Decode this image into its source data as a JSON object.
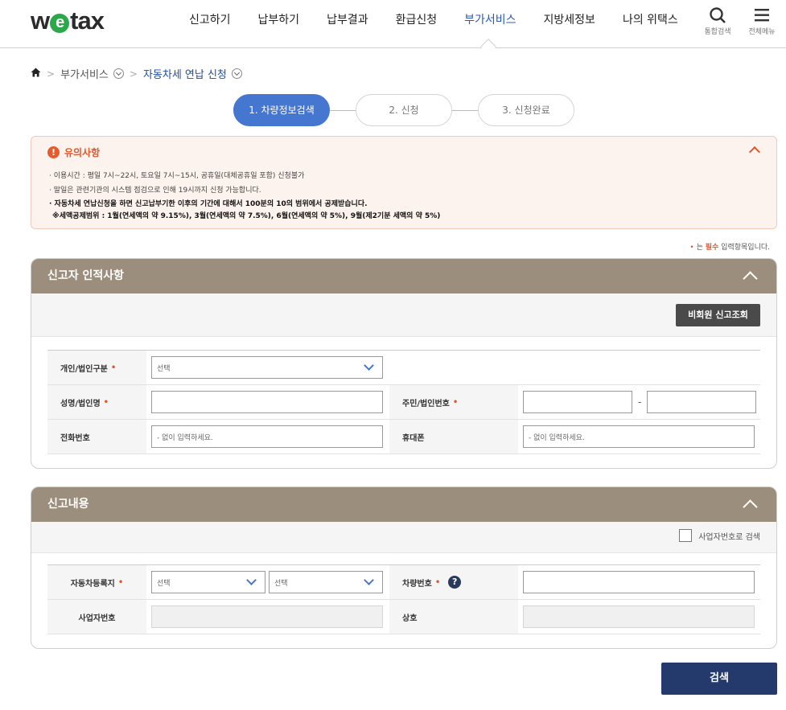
{
  "header": {
    "logo_pre": "w",
    "logo_e": "e",
    "logo_post": "tax",
    "menu": [
      "신고하기",
      "납부하기",
      "납부결과",
      "환급신청",
      "부가서비스",
      "지방세정보",
      "나의 위택스"
    ],
    "active_menu": "부가서비스",
    "search_label": "통합검색",
    "all_menu_label": "전체메뉴"
  },
  "breadcrumb": {
    "parent": "부가서비스",
    "current": "자동차세 연납 신청"
  },
  "steps": [
    "1. 차량정보검색",
    "2. 신청",
    "3. 신청완료"
  ],
  "active_step": 0,
  "notice": {
    "title": "유의사항",
    "lines": [
      "· 이용시간 : 평일 7시~22시, 토요일 7시~15시, 공휴일(대체공휴일 포함) 신청불가",
      "· 말일은 관련기관의 시스템 점검으로 인해 19시까지 신청 가능합니다."
    ],
    "bold_line_1": "· 자동차세 연납신청을 하면 신고납부기한 이후의 기간에 대해서 100분의 10의 범위에서 공제받습니다.",
    "bold_line_2": "※세액공제범위 : 1월(연세액의 약 9.15%), 3월(연세액의 약 7.5%), 6월(연세액의 약 5%), 9월(제2기분 세액의 약 5%)"
  },
  "required_note": {
    "mark": "•",
    "pre": " 는 ",
    "word": "필수",
    "post": " 입력항목입니다."
  },
  "section1": {
    "title": "신고자 인적사항",
    "button": "비회원 신고조회",
    "fields": {
      "type_label": "개인/법인구분",
      "type_value": "선택",
      "name_label": "성명/법인명",
      "id_label": "주민/법인번호",
      "id_dash": "-",
      "phone_label": "전화번호",
      "phone_placeholder": "- 없이 입력하세요.",
      "mobile_label": "휴대폰",
      "mobile_placeholder": "- 없이 입력하세요."
    }
  },
  "section2": {
    "title": "신고내용",
    "checkbox_label": "사업자번호로 검색",
    "fields": {
      "region_label": "자동차등록지",
      "region_sel1": "선택",
      "region_sel2": "선택",
      "car_label": "차량번호",
      "help": "?",
      "biz_label": "사업자번호",
      "shop_label": "상호"
    }
  },
  "search_button": "검색",
  "required_mark": "•",
  "colors": {
    "brand_green": "#2aa84a",
    "active_blue": "#4677d0",
    "panel_header": "#9b8e7c",
    "notice_accent": "#e0572a",
    "search_button": "#253a6c"
  }
}
